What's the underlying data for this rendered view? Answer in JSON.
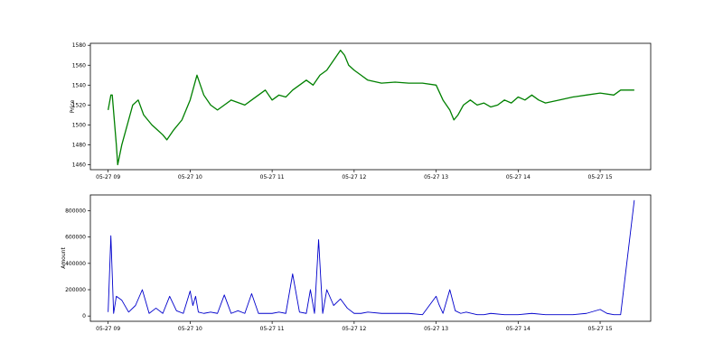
{
  "chart_data": [
    {
      "type": "line",
      "title": "",
      "xlabel": "",
      "ylabel": "Price",
      "color": "#008000",
      "xlim": [
        "2024-05-27 08:47",
        "2024-05-27 15:37"
      ],
      "ylim": [
        1455,
        1582
      ],
      "grid": false,
      "legend": "none",
      "x_ticks": [
        "05-27 09",
        "05-27 10",
        "05-27 11",
        "05-27 12",
        "05-27 13",
        "05-27 14",
        "05-27 15"
      ],
      "y_ticks": [
        1460,
        1480,
        1500,
        1520,
        1540,
        1560,
        1580
      ],
      "series": [
        {
          "x": [
            "2024-05-27 09:00",
            "2024-05-27 09:02",
            "2024-05-27 09:03",
            "2024-05-27 09:06",
            "2024-05-27 09:07",
            "2024-05-27 09:10",
            "2024-05-27 09:13",
            "2024-05-27 09:16",
            "2024-05-27 09:18",
            "2024-05-27 09:22",
            "2024-05-27 09:26",
            "2024-05-27 09:32",
            "2024-05-27 09:36",
            "2024-05-27 09:40",
            "2024-05-27 09:43",
            "2024-05-27 09:48",
            "2024-05-27 09:54",
            "2024-05-27 09:57",
            "2024-05-27 10:00",
            "2024-05-27 10:05",
            "2024-05-27 10:10",
            "2024-05-27 10:15",
            "2024-05-27 10:20",
            "2024-05-27 10:25",
            "2024-05-27 10:30",
            "2024-05-27 10:40",
            "2024-05-27 10:45",
            "2024-05-27 10:50",
            "2024-05-27 10:55",
            "2024-05-27 11:00",
            "2024-05-27 11:05",
            "2024-05-27 11:10",
            "2024-05-27 11:15",
            "2024-05-27 11:20",
            "2024-05-27 11:25",
            "2024-05-27 11:30",
            "2024-05-27 11:35",
            "2024-05-27 11:40",
            "2024-05-27 11:45",
            "2024-05-27 11:50",
            "2024-05-27 11:53",
            "2024-05-27 11:56",
            "2024-05-27 12:00",
            "2024-05-27 12:05",
            "2024-05-27 12:10",
            "2024-05-27 12:20",
            "2024-05-27 12:30",
            "2024-05-27 12:40",
            "2024-05-27 12:50",
            "2024-05-27 13:00",
            "2024-05-27 13:05",
            "2024-05-27 13:10",
            "2024-05-27 13:13",
            "2024-05-27 13:16",
            "2024-05-27 13:20",
            "2024-05-27 13:25",
            "2024-05-27 13:30",
            "2024-05-27 13:35",
            "2024-05-27 13:40",
            "2024-05-27 13:45",
            "2024-05-27 13:50",
            "2024-05-27 13:55",
            "2024-05-27 14:00",
            "2024-05-27 14:05",
            "2024-05-27 14:10",
            "2024-05-27 14:15",
            "2024-05-27 14:20",
            "2024-05-27 14:30",
            "2024-05-27 14:40",
            "2024-05-27 14:50",
            "2024-05-27 15:00",
            "2024-05-27 15:10",
            "2024-05-27 15:15",
            "2024-05-27 15:25"
          ],
          "y": [
            1515,
            1530,
            1530,
            1480,
            1460,
            1480,
            1495,
            1510,
            1520,
            1525,
            1510,
            1500,
            1495,
            1490,
            1485,
            1495,
            1505,
            1515,
            1525,
            1550,
            1530,
            1520,
            1515,
            1520,
            1525,
            1520,
            1525,
            1530,
            1535,
            1525,
            1530,
            1528,
            1535,
            1540,
            1545,
            1540,
            1550,
            1555,
            1565,
            1575,
            1570,
            1560,
            1555,
            1550,
            1545,
            1542,
            1543,
            1542,
            1542,
            1540,
            1525,
            1515,
            1505,
            1510,
            1520,
            1525,
            1520,
            1522,
            1518,
            1520,
            1525,
            1522,
            1528,
            1525,
            1530,
            1525,
            1522,
            1525,
            1528,
            1530,
            1532,
            1530,
            1535,
            1535
          ]
        }
      ]
    },
    {
      "type": "line",
      "title": "",
      "xlabel": "",
      "ylabel": "Amount",
      "color": "#0000cc",
      "xlim": [
        "2024-05-27 08:47",
        "2024-05-27 15:37"
      ],
      "ylim": [
        -40000,
        920000
      ],
      "grid": false,
      "legend": "none",
      "x_ticks": [
        "05-27 09",
        "05-27 10",
        "05-27 11",
        "05-27 12",
        "05-27 13",
        "05-27 14",
        "05-27 15"
      ],
      "y_ticks": [
        0,
        200000,
        400000,
        600000,
        800000
      ],
      "y_tick_labels": [
        "0",
        "200000",
        "400000",
        "600000",
        "800000"
      ],
      "series": [
        {
          "x": [
            "2024-05-27 09:00",
            "2024-05-27 09:02",
            "2024-05-27 09:04",
            "2024-05-27 09:06",
            "2024-05-27 09:10",
            "2024-05-27 09:15",
            "2024-05-27 09:20",
            "2024-05-27 09:25",
            "2024-05-27 09:30",
            "2024-05-27 09:35",
            "2024-05-27 09:40",
            "2024-05-27 09:45",
            "2024-05-27 09:50",
            "2024-05-27 09:55",
            "2024-05-27 10:00",
            "2024-05-27 10:02",
            "2024-05-27 10:04",
            "2024-05-27 10:06",
            "2024-05-27 10:10",
            "2024-05-27 10:15",
            "2024-05-27 10:20",
            "2024-05-27 10:25",
            "2024-05-27 10:30",
            "2024-05-27 10:35",
            "2024-05-27 10:40",
            "2024-05-27 10:45",
            "2024-05-27 10:50",
            "2024-05-27 10:55",
            "2024-05-27 11:00",
            "2024-05-27 11:05",
            "2024-05-27 11:10",
            "2024-05-27 11:15",
            "2024-05-27 11:20",
            "2024-05-27 11:25",
            "2024-05-27 11:28",
            "2024-05-27 11:31",
            "2024-05-27 11:34",
            "2024-05-27 11:37",
            "2024-05-27 11:40",
            "2024-05-27 11:45",
            "2024-05-27 11:50",
            "2024-05-27 11:55",
            "2024-05-27 12:00",
            "2024-05-27 12:05",
            "2024-05-27 12:10",
            "2024-05-27 12:20",
            "2024-05-27 12:30",
            "2024-05-27 12:40",
            "2024-05-27 12:50",
            "2024-05-27 13:00",
            "2024-05-27 13:02",
            "2024-05-27 13:05",
            "2024-05-27 13:10",
            "2024-05-27 13:14",
            "2024-05-27 13:18",
            "2024-05-27 13:22",
            "2024-05-27 13:30",
            "2024-05-27 13:35",
            "2024-05-27 13:40",
            "2024-05-27 13:50",
            "2024-05-27 14:00",
            "2024-05-27 14:10",
            "2024-05-27 14:20",
            "2024-05-27 14:30",
            "2024-05-27 14:40",
            "2024-05-27 14:50",
            "2024-05-27 15:00",
            "2024-05-27 15:05",
            "2024-05-27 15:10",
            "2024-05-27 15:15",
            "2024-05-27 15:25"
          ],
          "y": [
            30000,
            610000,
            20000,
            150000,
            120000,
            30000,
            80000,
            200000,
            20000,
            60000,
            20000,
            150000,
            40000,
            20000,
            190000,
            80000,
            150000,
            30000,
            20000,
            30000,
            20000,
            160000,
            20000,
            40000,
            20000,
            170000,
            20000,
            20000,
            20000,
            30000,
            20000,
            320000,
            30000,
            20000,
            200000,
            20000,
            580000,
            20000,
            200000,
            80000,
            130000,
            60000,
            20000,
            20000,
            30000,
            20000,
            20000,
            20000,
            10000,
            150000,
            90000,
            20000,
            200000,
            40000,
            20000,
            30000,
            10000,
            10000,
            20000,
            10000,
            10000,
            20000,
            10000,
            10000,
            10000,
            20000,
            50000,
            20000,
            10000,
            10000,
            880000
          ]
        }
      ]
    }
  ]
}
